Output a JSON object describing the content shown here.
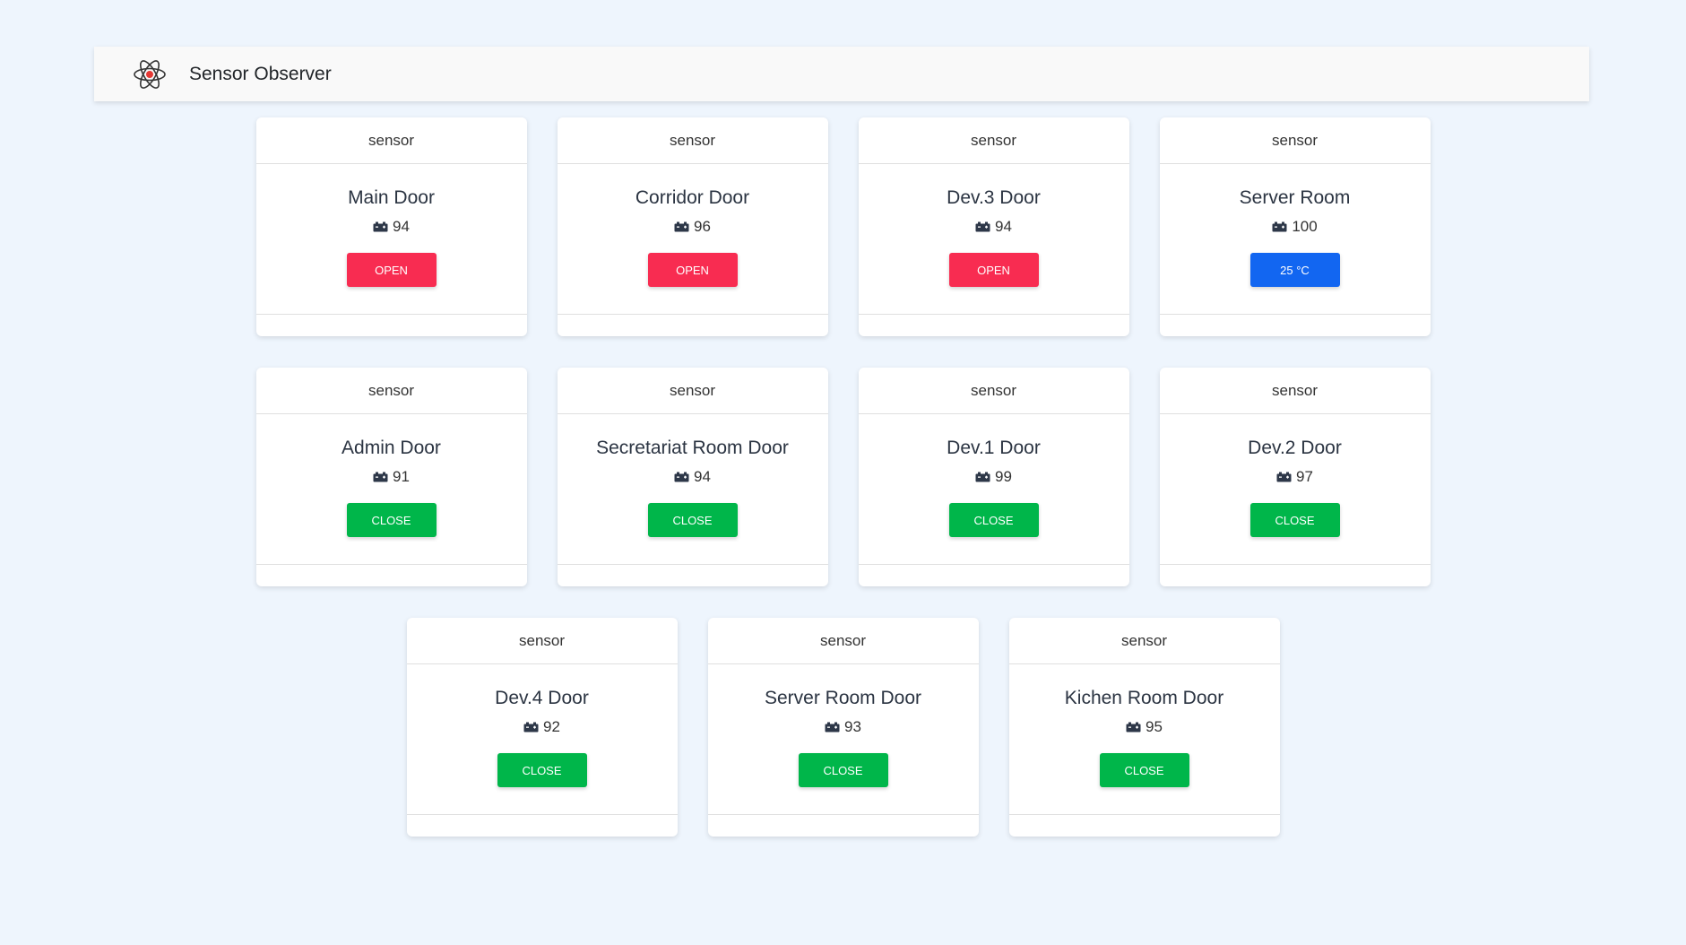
{
  "app": {
    "brand": "Sensor Observer",
    "logo_icon": "atom-icon"
  },
  "colors": {
    "background": "#eef5fd",
    "open": "#f82c51",
    "close": "#00b64a",
    "temperature": "#1266f1"
  },
  "sensors": [
    {
      "header": "sensor",
      "name": "Main Door",
      "battery": "94",
      "status": "OPEN",
      "state": "open"
    },
    {
      "header": "sensor",
      "name": "Corridor Door",
      "battery": "96",
      "status": "OPEN",
      "state": "open"
    },
    {
      "header": "sensor",
      "name": "Dev.3 Door",
      "battery": "94",
      "status": "OPEN",
      "state": "open"
    },
    {
      "header": "sensor",
      "name": "Server Room",
      "battery": "100",
      "status": "25 °C",
      "state": "temperature"
    },
    {
      "header": "sensor",
      "name": "Admin Door",
      "battery": "91",
      "status": "CLOSE",
      "state": "close"
    },
    {
      "header": "sensor",
      "name": "Secretariat Room Door",
      "battery": "94",
      "status": "CLOSE",
      "state": "close"
    },
    {
      "header": "sensor",
      "name": "Dev.1 Door",
      "battery": "99",
      "status": "CLOSE",
      "state": "close"
    },
    {
      "header": "sensor",
      "name": "Dev.2 Door",
      "battery": "97",
      "status": "CLOSE",
      "state": "close"
    },
    {
      "header": "sensor",
      "name": "Dev.4 Door",
      "battery": "92",
      "status": "CLOSE",
      "state": "close"
    },
    {
      "header": "sensor",
      "name": "Server Room Door",
      "battery": "93",
      "status": "CLOSE",
      "state": "close"
    },
    {
      "header": "sensor",
      "name": "Kichen Room Door",
      "battery": "95",
      "status": "CLOSE",
      "state": "close"
    }
  ]
}
